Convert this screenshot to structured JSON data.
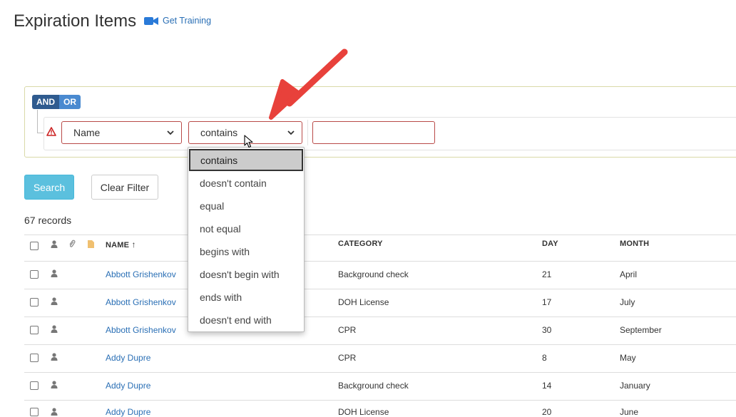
{
  "header": {
    "title": "Expiration Items",
    "training_label": "Get Training",
    "training_icon": "video-camera-icon"
  },
  "filter": {
    "logic": {
      "and_label": "AND",
      "or_label": "OR"
    },
    "field_select": {
      "value": "Name"
    },
    "operator_select": {
      "value": "contains"
    },
    "value_input": {
      "value": ""
    },
    "operator_options": [
      "contains",
      "doesn't contain",
      "equal",
      "not equal",
      "begins with",
      "doesn't begin with",
      "ends with",
      "doesn't end with"
    ],
    "selected_option": "contains"
  },
  "buttons": {
    "search_label": "Search",
    "clear_label": "Clear Filter"
  },
  "records_text": "67 records",
  "table": {
    "columns": {
      "name": "NAME",
      "category": "CATEGORY",
      "day": "DAY",
      "month": "MONTH"
    },
    "sort_indicator": "↑",
    "rows": [
      {
        "name": "Abbott Grishenkov",
        "category": "Background check",
        "day": "21",
        "month": "April"
      },
      {
        "name": "Abbott Grishenkov",
        "category": "DOH License",
        "day": "17",
        "month": "July"
      },
      {
        "name": "Abbott Grishenkov",
        "category": "CPR",
        "day": "30",
        "month": "September"
      },
      {
        "name": "Addy Dupre",
        "category": "CPR",
        "day": "8",
        "month": "May"
      },
      {
        "name": "Addy Dupre",
        "category": "Background check",
        "day": "14",
        "month": "January"
      },
      {
        "name": "Addy Dupre",
        "category": "DOH License",
        "day": "20",
        "month": "June"
      }
    ]
  },
  "colors": {
    "accent_link": "#2a6fb5",
    "error_border": "#b94a48",
    "search_button": "#5bc0de",
    "annotation_arrow": "#e8413b"
  }
}
